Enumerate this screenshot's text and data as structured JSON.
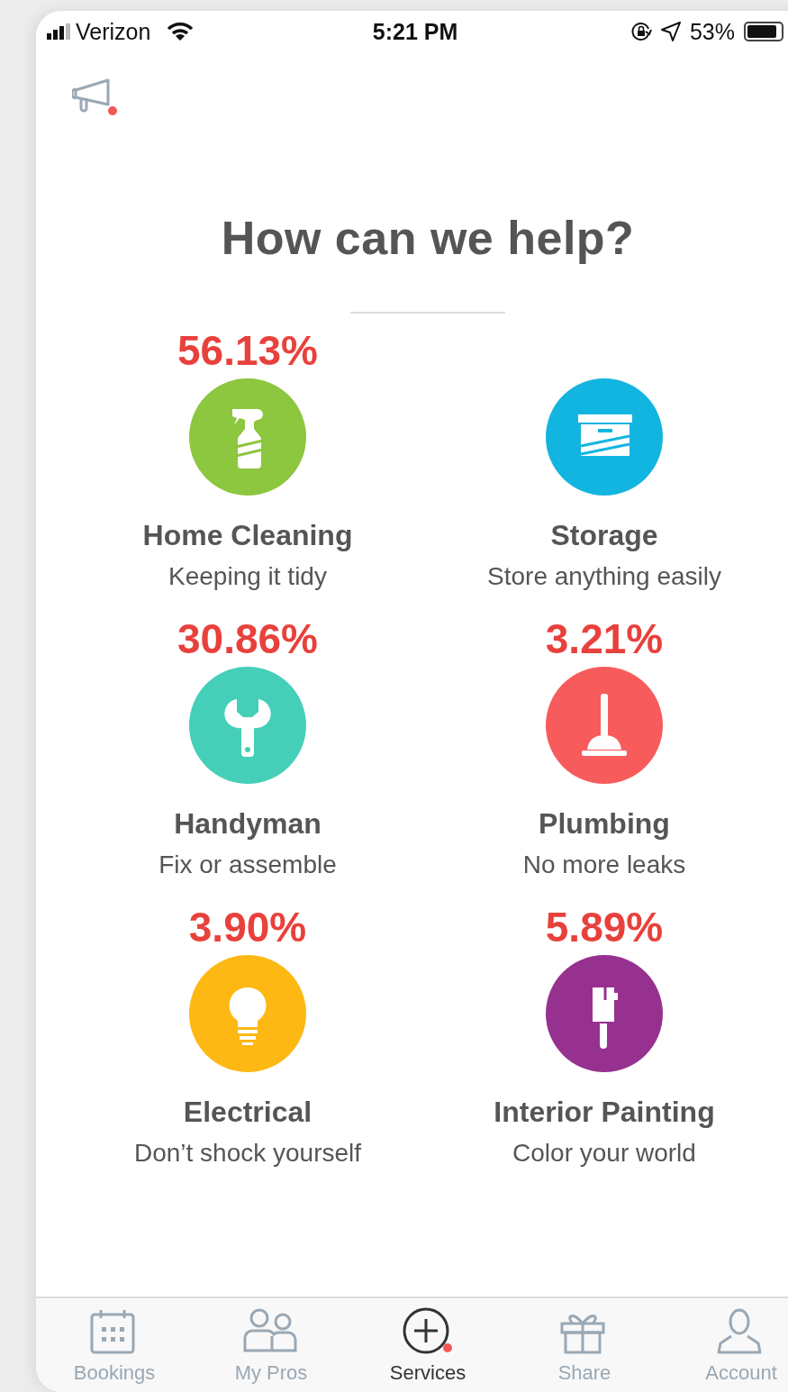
{
  "status_bar": {
    "carrier": "Verizon",
    "time": "5:21 PM",
    "battery": "53%"
  },
  "announcements": {
    "notification_dot": true
  },
  "title": "How can we help?",
  "services": [
    {
      "percent": "56.13%",
      "name": "Home Cleaning",
      "subtitle": "Keeping it tidy",
      "kind": "spray",
      "color": "#8dc63f"
    },
    {
      "name": "Storage",
      "subtitle": "Store anything easily",
      "kind": "box",
      "color": "#12b5e0"
    },
    {
      "percent": "30.86%",
      "name": "Handyman",
      "subtitle": "Fix or assemble",
      "kind": "wrench",
      "color": "#45cfb8"
    },
    {
      "percent": "3.21%",
      "name": "Plumbing",
      "subtitle": "No more leaks",
      "kind": "plunger",
      "color": "#f85b5b"
    },
    {
      "percent": "3.90%",
      "name": "Electrical",
      "subtitle": "Don’t shock yourself",
      "kind": "bulb",
      "color": "#fdb813"
    },
    {
      "percent": "5.89%",
      "name": "Interior Painting",
      "subtitle": "Color your world",
      "kind": "brush",
      "color": "#97318f"
    }
  ],
  "tabs": [
    {
      "label": "Bookings",
      "kind": "calendar",
      "selected": false,
      "notification_dot": false
    },
    {
      "label": "My Pros",
      "kind": "people",
      "selected": false,
      "notification_dot": false
    },
    {
      "label": "Services",
      "kind": "plus",
      "selected": true,
      "notification_dot": true
    },
    {
      "label": "Share",
      "kind": "gift",
      "selected": false,
      "notification_dot": false
    },
    {
      "label": "Account",
      "kind": "person",
      "selected": false,
      "notification_dot": false
    }
  ]
}
